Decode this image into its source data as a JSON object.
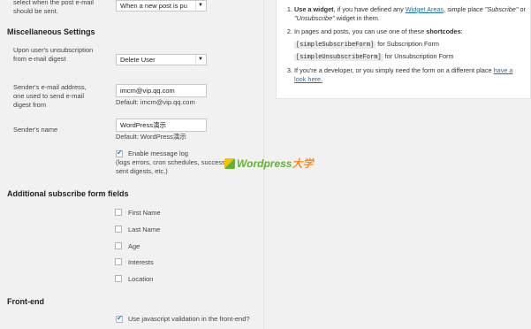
{
  "top": {
    "label_tail": "select when the post e-mail should be sent.",
    "select_value": "When a new post is pu"
  },
  "misc": {
    "heading": "Miscellaneous Settings",
    "unsub_label": "Upon user's unsubscription from e-mail digest",
    "unsub_value": "Delete User",
    "sender_email_label": "Sender's e-mail address, one used to send e-mail digest from",
    "sender_email_value": "imcm@vip.qq.com",
    "sender_email_default": "Default: imcm@vip.qq.com",
    "sender_name_label": "Sender's name",
    "sender_name_value": "WordPress演示",
    "sender_name_default": "Default: WordPress演示",
    "log_checkbox_label": "Enable message log",
    "log_desc": "(logs errors, cron schedules, successful sent digests, etc.)"
  },
  "fields": {
    "heading": "Additional subscribe form fields",
    "items": [
      "First Name",
      "Last Name",
      "Age",
      "Interests",
      "Location"
    ]
  },
  "frontend": {
    "heading": "Front-end",
    "js_validation": "Use javascript validation in the front-end?"
  },
  "help": {
    "item1_bold": "Use a widget",
    "item1_pre": ", if you have defined any ",
    "item1_link": "Widget Areas",
    "item1_post": ", simple place ",
    "item1_sub": "\"Subscribe\"",
    "item1_or": " or ",
    "item1_unsub": "\"Unsubscribe\"",
    "item1_tail": " widget in them.",
    "item2_pre": "In pages and posts, you can use one of these ",
    "item2_bold": "shortcodes",
    "item2_colon": ":",
    "code1": "[simpleSubscribeForm]",
    "code1_desc": " for Subscription Form",
    "code2": "[simpleUnsubscribeForm]",
    "code2_desc": " for Unsubscription Form",
    "item3_pre": "If you're a developer, or you simply need the form on a different place ",
    "item3_link": "have a look here."
  },
  "watermark": {
    "brand": "Wordpress",
    "suffix": "大学"
  }
}
